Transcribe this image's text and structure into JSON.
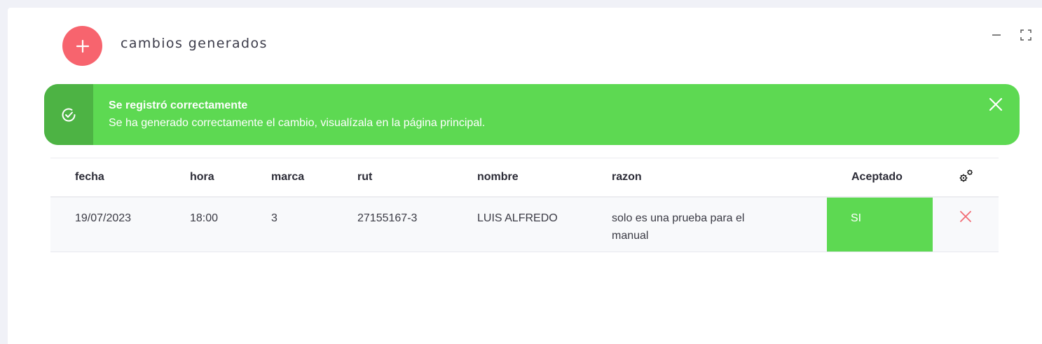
{
  "panel": {
    "title": "cambios generados",
    "add_icon": "plus-icon",
    "minimize_icon": "minimize-icon",
    "maximize_icon": "fullscreen-icon"
  },
  "alert": {
    "icon": "check-circle-icon",
    "title": "Se registró correctamente",
    "message": "Se ha generado correctamente el cambio, visualízala en la página principal.",
    "close_icon": "close-icon",
    "color": "#5dd952",
    "icon_bg": "#4db344"
  },
  "table": {
    "headers": {
      "fecha": "fecha",
      "hora": "hora",
      "marca": "marca",
      "rut": "rut",
      "nombre": "nombre",
      "razon": "razon",
      "aceptado": "Aceptado",
      "actions_icon": "gears-icon"
    },
    "rows": [
      {
        "fecha": "19/07/2023",
        "hora": "18:00",
        "marca": "3",
        "rut": "27155167-3",
        "nombre": "LUIS ALFREDO",
        "razon": "solo es una prueba para el manual",
        "aceptado": "SI",
        "delete_icon": "close-icon"
      }
    ]
  },
  "colors": {
    "accent_red": "#f7646e",
    "success_green": "#5dd952"
  }
}
